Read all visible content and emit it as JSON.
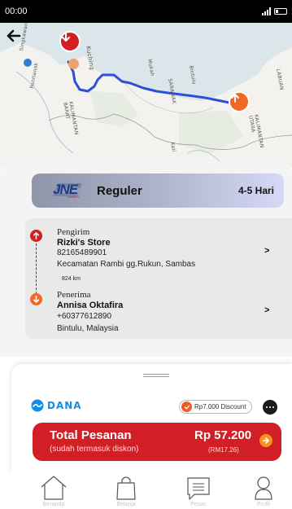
{
  "status_bar": {
    "time": "00:00"
  },
  "map": {
    "labels": {
      "singkawang": "Singkawang",
      "pontianak": "Pontianak",
      "kuching": "Kuching",
      "mukah": "Mukah",
      "sarawak": "SARAWAK",
      "bintulu": "Bintulu",
      "labuan": "LABUAN",
      "kalimantan_barat": "KALIMANTAN BARAT",
      "kalimantan_utara": "KALIMANTAN UTARA",
      "kalimantan_short": "Kali"
    },
    "colors": {
      "route": "#2b4fd8",
      "origin_pin": "#d21f26",
      "destination_pin": "#f26722",
      "land": "#f4f2ee",
      "sea": "#dbe6ea"
    }
  },
  "courier": {
    "logo": "JNE",
    "logo_sub": "EXPRESS",
    "service": "Reguler",
    "eta": "4-5 Hari"
  },
  "sender": {
    "role": "Pengirim",
    "name": "Rizki's Store",
    "phone": "82165489901",
    "address": "Kecamatan Rambi gg.Rukun, Sambas",
    "chevron": ">"
  },
  "distance": "824 km",
  "receiver": {
    "role": "Penerima",
    "name": "Annisa Oktafira",
    "phone": "+60377612890",
    "address": "Bintulu, Malaysia",
    "chevron": ">"
  },
  "payment": {
    "method": "DANA",
    "discount_label": "Rp7.000 Discount",
    "total_label": "Total Pesanan",
    "total_note": "(sudah termasuk diskon)",
    "total_amount": "Rp 57.200",
    "total_converted": "(RM17.26)"
  },
  "nav": {
    "items": [
      {
        "label": "Beranda",
        "icon": "home-icon"
      },
      {
        "label": "Belanja",
        "icon": "shopping-bag-icon"
      },
      {
        "label": "Pesan",
        "icon": "message-icon"
      },
      {
        "label": "Profil",
        "icon": "profile-icon"
      }
    ]
  }
}
